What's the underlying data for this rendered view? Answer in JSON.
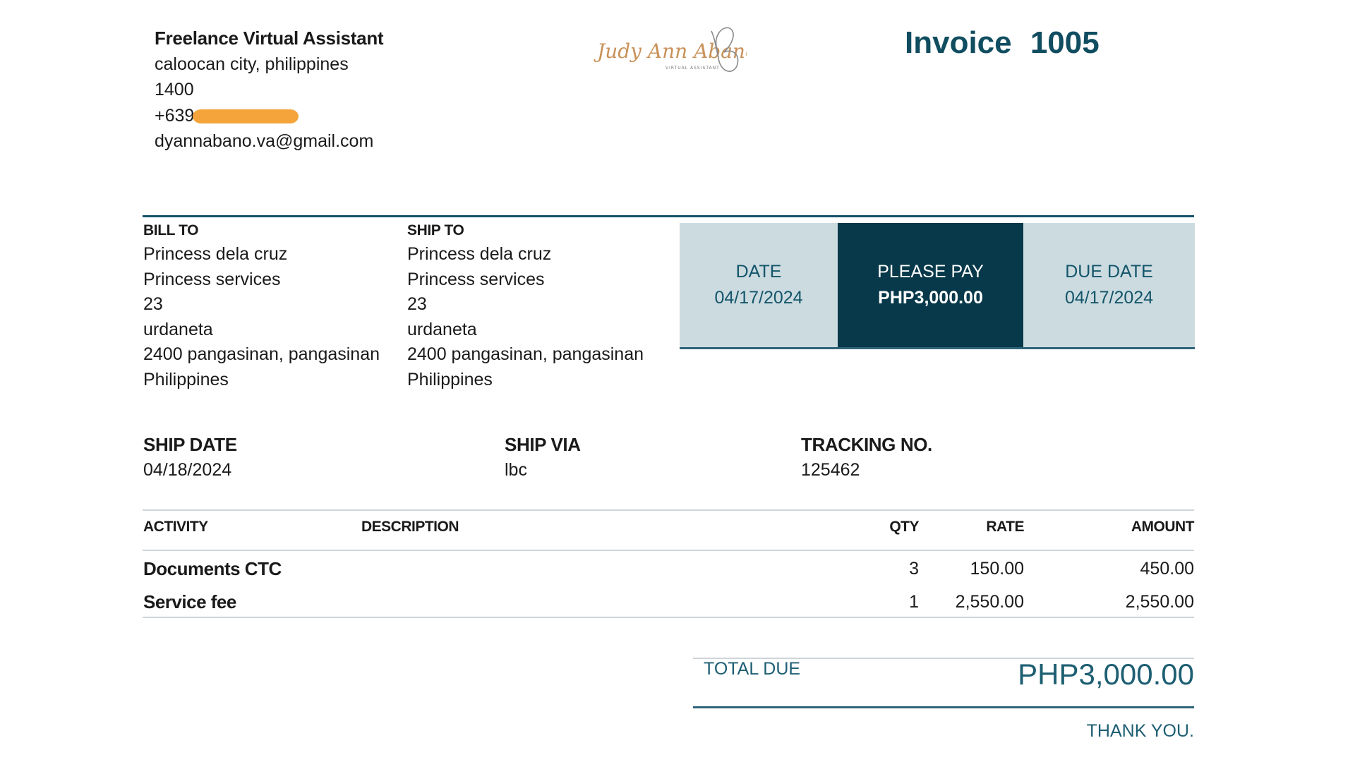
{
  "company": {
    "name": "Freelance Virtual Assistant",
    "address_line1": "caloocan city, philippines",
    "postal": "1400",
    "phone": "+639",
    "email": "dyannabano.va@gmail.com"
  },
  "logo": {
    "signature": "Judy Ann Abano",
    "tagline": "VIRTUAL ASSISTANT",
    "icon": "butterfly-icon"
  },
  "invoice": {
    "title": "Invoice  1005"
  },
  "bill_to": {
    "header": "BILL TO",
    "lines": [
      "Princess dela cruz",
      "Princess services",
      "23",
      "urdaneta",
      "2400 pangasinan, pangasinan",
      "Philippines"
    ]
  },
  "ship_to": {
    "header": "SHIP TO",
    "lines": [
      "Princess dela cruz",
      "Princess services",
      "23",
      "urdaneta",
      "2400 pangasinan, pangasinan",
      "Philippines"
    ]
  },
  "summary": {
    "date_label": "DATE",
    "date_value": "04/17/2024",
    "pay_label": "PLEASE PAY",
    "pay_value": "PHP3,000.00",
    "due_label": "DUE DATE",
    "due_value": "04/17/2024"
  },
  "shipping": {
    "ship_date_label": "SHIP DATE",
    "ship_date_value": "04/18/2024",
    "ship_via_label": "SHIP VIA",
    "ship_via_value": "lbc",
    "tracking_label": "TRACKING NO.",
    "tracking_value": "125462"
  },
  "table": {
    "headers": {
      "activity": "ACTIVITY",
      "description": "DESCRIPTION",
      "qty": "QTY",
      "rate": "RATE",
      "amount": "AMOUNT"
    },
    "rows": [
      {
        "activity": "Documents CTC",
        "description": "",
        "qty": "3",
        "rate": "150.00",
        "amount": "450.00"
      },
      {
        "activity": "Service fee",
        "description": "",
        "qty": "1",
        "rate": "2,550.00",
        "amount": "2,550.00"
      }
    ]
  },
  "total": {
    "label": "TOTAL DUE",
    "value": "PHP3,000.00"
  },
  "footer": {
    "thanks": "THANK YOU."
  },
  "colors": {
    "accent": "#114d60",
    "dark_box": "#07394a",
    "light_box": "#ccdbe0",
    "redaction": "#f4a43b"
  }
}
